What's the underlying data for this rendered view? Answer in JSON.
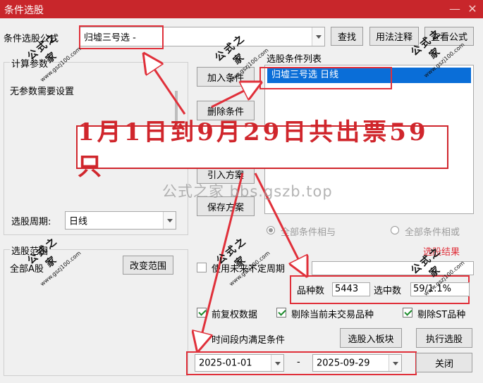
{
  "window": {
    "title": "条件选股",
    "minimize_symbol": "—",
    "close_symbol": "✕"
  },
  "formula": {
    "label": "条件选股公式",
    "value": "归墟三号选  -",
    "find_label": "查找",
    "usage_label": "用法注释",
    "view_label": "查看公式"
  },
  "params": {
    "group_label": "计算参数",
    "text": "无参数需要设置"
  },
  "period": {
    "label": "选股周期:",
    "value": "日线"
  },
  "scope": {
    "group_label": "选股范围",
    "value": "全部A股",
    "change_label": "改变范围"
  },
  "actions": {
    "add_label": "加入条件",
    "delete_label": "删除条件",
    "import_label": "引入方案",
    "save_label": "保存方案"
  },
  "conditions": {
    "label": "选股条件列表",
    "items": [
      "归墟三号选  日线"
    ]
  },
  "logic": {
    "and_label": "全部条件相与",
    "or_label": "全部条件相或"
  },
  "result": {
    "link_label": "选股结果",
    "variety_label": "品种数",
    "variety_value": "5443",
    "selected_label": "选中数",
    "selected_value": "59/1.1%"
  },
  "options": {
    "nonfixed_label": "使用未来不定周期",
    "adj_label": "前复权数据",
    "exclude_untraded_label": "剔除当前未交易品种",
    "exclude_st_label": "剔除ST品种",
    "timerange_label": "时间段内满足条件"
  },
  "dates": {
    "start": "2025-01-01",
    "separator": "-",
    "end": "2025-09-29"
  },
  "bottom": {
    "to_block_label": "选股入板块",
    "run_label": "执行选股",
    "close_label": "关闭"
  },
  "banner": {
    "text": "1月1日到9月29日共出票59只"
  },
  "watermark": {
    "text": "公式之家 bbs.gszb.top",
    "stamp_text": "公式之家",
    "stamp_url": "www.gszj100.com"
  },
  "colors": {
    "title_bar": "#c8262b",
    "selection": "#0a6ed8",
    "annotation_red": "#e0303a"
  }
}
